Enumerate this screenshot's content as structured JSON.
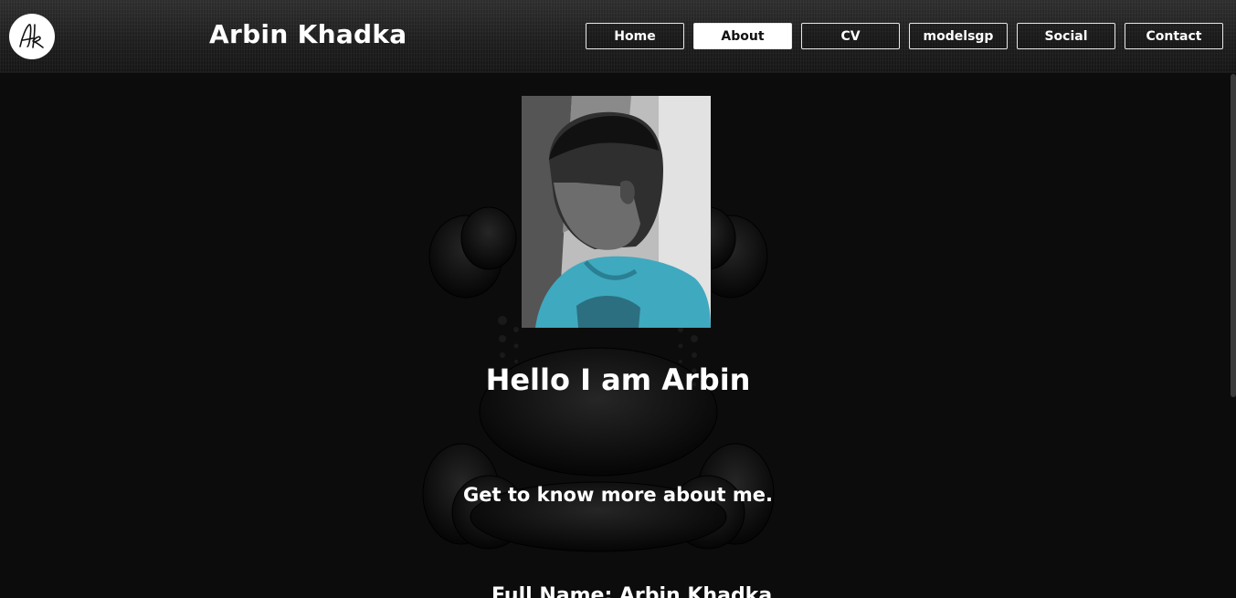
{
  "header": {
    "logo_text": "Ak",
    "site_title": "Arbin Khadka"
  },
  "nav": {
    "items": [
      {
        "label": "Home",
        "active": false
      },
      {
        "label": "About",
        "active": true
      },
      {
        "label": "CV",
        "active": false
      },
      {
        "label": "modelsgp",
        "active": false
      },
      {
        "label": "Social",
        "active": false
      },
      {
        "label": "Contact",
        "active": false
      }
    ]
  },
  "about": {
    "heading": "Hello I am Arbin",
    "tagline": "Get to know more about me.",
    "full_name_line": "Full Name: Arbin Khadka"
  },
  "colors": {
    "background": "#0c0c0c",
    "header": "#222222",
    "text": "#ffffff",
    "shirt": "#3fa9bf"
  },
  "icons": {
    "logo": "ak-monogram-icon",
    "photo": "profile-photo"
  }
}
